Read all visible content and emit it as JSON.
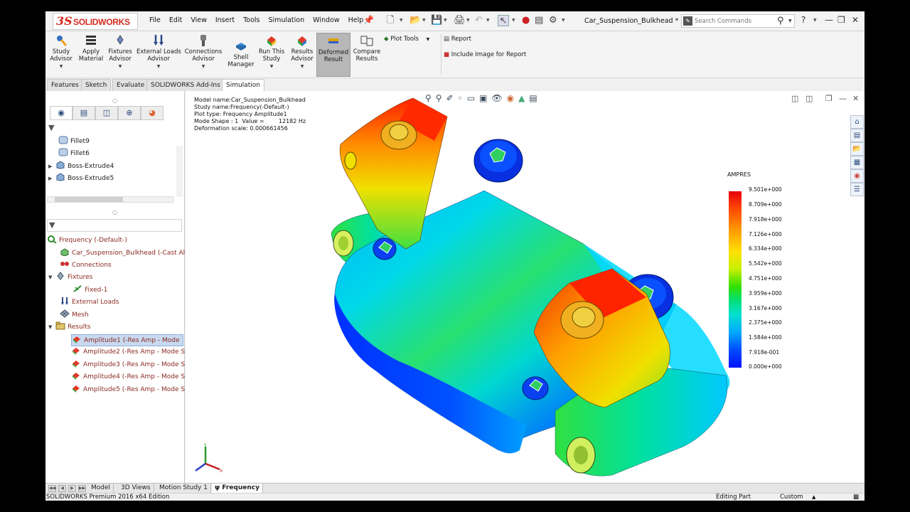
{
  "app": {
    "brand": "SOLIDWORKS",
    "document_title": "Car_Suspension_Bulkhead *"
  },
  "menu": [
    "File",
    "Edit",
    "View",
    "Insert",
    "Tools",
    "Simulation",
    "Window",
    "Help"
  ],
  "search": {
    "placeholder": "Search Commands"
  },
  "ribbon": {
    "study_advisor": "Study\nAdvisor",
    "apply_material": "Apply\nMaterial",
    "fixtures_advisor": "Fixtures\nAdvisor",
    "external_loads_advisor": "External Loads\nAdvisor",
    "connections_advisor": "Connections\nAdvisor",
    "shell_manager": "Shell\nManager",
    "run_this_study": "Run This\nStudy",
    "results_advisor": "Results\nAdvisor",
    "deformed_result": "Deformed\nResult",
    "compare_results": "Compare\nResults",
    "plot_tools": "Plot Tools",
    "report": "Report",
    "include_image": "Include Image for Report"
  },
  "command_tabs": [
    "Features",
    "Sketch",
    "Evaluate",
    "SOLIDWORKS Add-Ins",
    "Simulation"
  ],
  "feature_tree": [
    {
      "label": "Fillet9",
      "type": "fillet"
    },
    {
      "label": "Fillet6",
      "type": "fillet"
    },
    {
      "label": "Boss-Extrude4",
      "type": "boss"
    },
    {
      "label": "Boss-Extrude5",
      "type": "boss"
    }
  ],
  "study_tree": {
    "root": "Frequency (-Default-)",
    "part": "Car_Suspension_Bulkhead (-Cast Allo",
    "connections": "Connections",
    "fixtures": "Fixtures",
    "fixed": "Fixed-1",
    "external_loads": "External Loads",
    "mesh": "Mesh",
    "results": "Results",
    "result_items": [
      "Amplitude1 (-Res Amp - Mode",
      "Amplitude2 (-Res Amp - Mode S",
      "Amplitude3 (-Res Amp - Mode S",
      "Amplitude4 (-Res Amp - Mode S",
      "Amplitude5 (-Res Amp - Mode S"
    ]
  },
  "plot_info": {
    "line1": "Model name:Car_Suspension_Bulkhead",
    "line2": "Study name:Frequency(-Default-)",
    "line3": "Plot type: Frequency Amplitude1",
    "line4": "Mode Shape : 1  Value =        12182 Hz",
    "line5": "Deformation scale: 0.000661456"
  },
  "legend": {
    "title": "AMPRES",
    "values": [
      "9.501e+000",
      "8.709e+000",
      "7.918e+000",
      "7.126e+000",
      "6.334e+000",
      "5.542e+000",
      "4.751e+000",
      "3.959e+000",
      "3.167e+000",
      "2.375e+000",
      "1.584e+000",
      "7.918e-001",
      "0.000e+000"
    ]
  },
  "bottom_tabs": [
    "Model",
    "3D Views",
    "Motion Study 1",
    "Frequency"
  ],
  "status": {
    "edition": "SOLIDWORKS Premium 2016 x64 Edition",
    "mode": "Editing Part",
    "units": "Custom"
  },
  "colors": {
    "brand_red": "#d52b1e",
    "selection_blue": "#c9d9ef",
    "tree_red_text": "#8a2a20"
  }
}
